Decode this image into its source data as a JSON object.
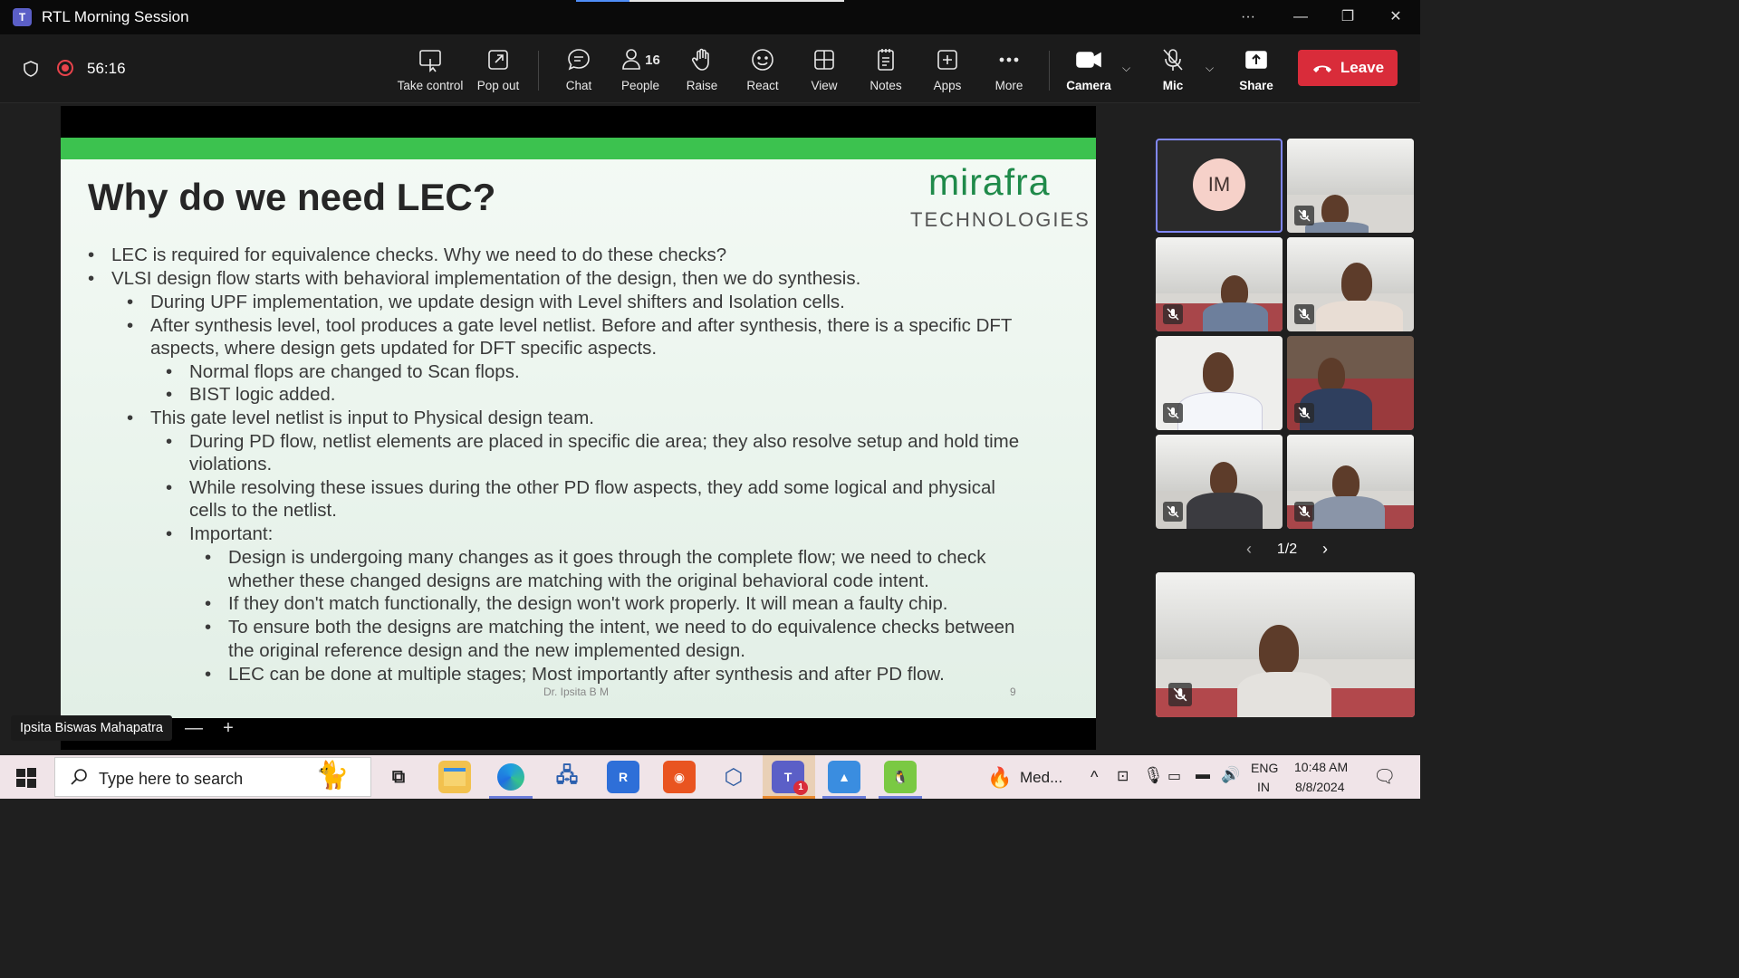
{
  "window": {
    "title": "RTL Morning Session",
    "app_icon_text": "T",
    "loading_progress": 0.2
  },
  "toolbar": {
    "timer": "56:16",
    "buttons": {
      "take_control": "Take control",
      "pop_out": "Pop out",
      "chat": "Chat",
      "people": "People",
      "people_count": "16",
      "raise": "Raise",
      "react": "React",
      "view": "View",
      "notes": "Notes",
      "apps": "Apps",
      "more": "More",
      "camera": "Camera",
      "mic": "Mic",
      "share": "Share",
      "leave": "Leave"
    }
  },
  "slide": {
    "title": "Why do we need LEC?",
    "brand_name": "mirafra",
    "brand_sub": "TECHNOLOGIES",
    "bullets": [
      "LEC is required for equivalence checks. Why we need to do these checks?",
      "VLSI design flow starts with behavioral implementation of the design, then we do synthesis.",
      "During UPF implementation, we update design with Level shifters and Isolation cells.",
      "After synthesis level, tool produces a gate level netlist. Before and after synthesis, there is a specific DFT",
      "aspects, where design gets updated for DFT specific aspects.",
      "Normal flops are changed to Scan flops.",
      "BIST logic added.",
      "This gate level netlist is input to Physical design team.",
      "During PD flow, netlist elements are placed in specific die area; they also resolve setup and hold time",
      "violations.",
      "While resolving these issues during the other PD flow aspects, they add some logical and physical",
      "cells to the netlist.",
      "Important:",
      "Design is undergoing many changes as it goes through the complete flow; we need to check",
      "whether these changed designs are matching with the original behavioral code intent.",
      "If they don't match functionally, the design won't work properly. It will mean a faulty chip.",
      "To ensure both the designs are matching the intent, we need to do equivalence checks between",
      "the original reference design and the new implemented design.",
      "LEC can be done at multiple stages; Most importantly after synthesis and after PD flow."
    ],
    "footer": "Dr. Ipsita B M",
    "page_number": "9"
  },
  "presenter": {
    "name": "Ipsita Biswas Mahapatra",
    "zoom_out": "—",
    "zoom_in": "+"
  },
  "participants": {
    "avatar_initials": "IM",
    "page": "1/2"
  },
  "taskbar": {
    "search_placeholder": "Type here to search",
    "media_label": "Med...",
    "lang_top": "ENG",
    "lang_bottom": "IN",
    "time": "10:48 AM",
    "date": "8/8/2024",
    "teams_badge": "1"
  }
}
